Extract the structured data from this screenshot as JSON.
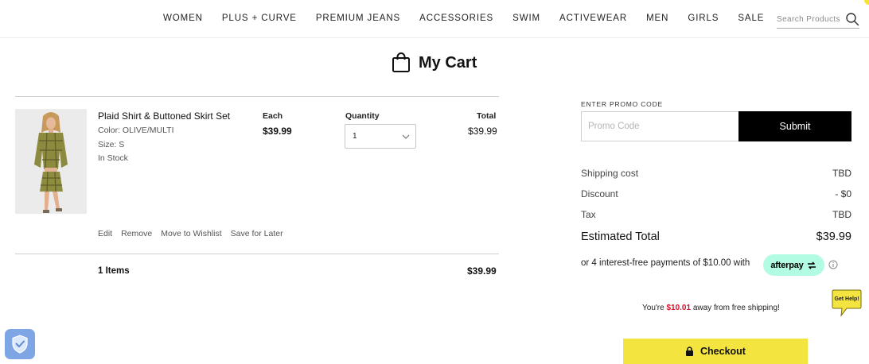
{
  "nav": {
    "links": [
      "WOMEN",
      "PLUS + CURVE",
      "PREMIUM JEANS",
      "ACCESSORIES",
      "SWIM",
      "ACTIVEWEAR",
      "MEN",
      "GIRLS",
      "SALE"
    ],
    "search_placeholder": "Search Products",
    "search_icon": "search-icon"
  },
  "page": {
    "title": "My Cart",
    "title_icon": "shopping-bag-icon"
  },
  "cart": {
    "item": {
      "name": "Plaid Shirt & Buttoned Skirt Set",
      "color": "Color: OLIVE/MULTI",
      "size": "Size: S",
      "stock": "In Stock",
      "each_label": "Each",
      "each_price": "$39.99",
      "quantity_label": "Quantity",
      "quantity_value": "1",
      "total_label": "Total",
      "total_price": "$39.99",
      "actions": [
        "Edit",
        "Remove",
        "Move to Wishlist",
        "Save for Later"
      ]
    },
    "items_count": "1 Items",
    "items_total": "$39.99"
  },
  "promo": {
    "label": "ENTER PROMO CODE",
    "placeholder": "Promo Code",
    "submit_label": "Submit"
  },
  "summary": {
    "rows": [
      {
        "label": "Shipping cost",
        "value": "TBD"
      },
      {
        "label": "Discount",
        "value": "- $0"
      },
      {
        "label": "Tax",
        "value": "TBD"
      }
    ],
    "estimated_label": "Estimated Total",
    "estimated_value": "$39.99",
    "installments_text": "or 4 interest-free payments of $10.00 with",
    "afterpay_label": "afterpay"
  },
  "shipping": {
    "prefix": "You're ",
    "amount": "$10.01",
    "suffix": " away from free shipping!"
  },
  "help": {
    "label": "Get Help!"
  },
  "checkout": {
    "label": "Checkout",
    "icon": "lock-icon"
  },
  "colors": {
    "accent_yellow": "#f4e43f",
    "afterpay_mint": "#b2fce4",
    "shipping_red": "#d2102b",
    "submit_black": "#000000",
    "shield_blue": "#7ea5e4"
  }
}
